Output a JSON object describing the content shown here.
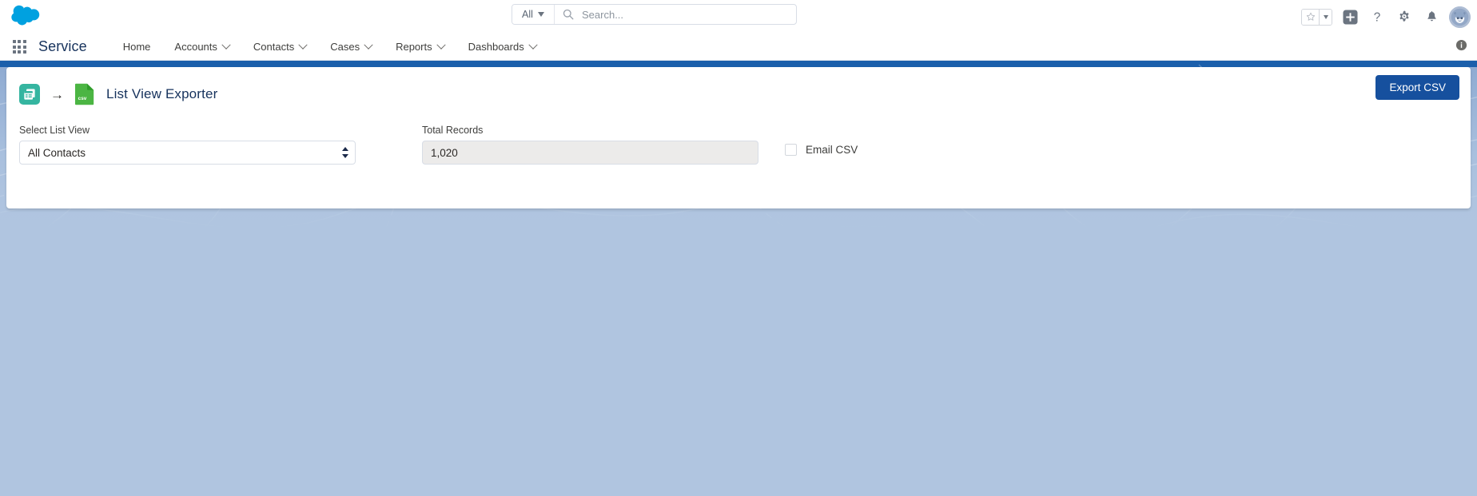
{
  "header": {
    "logo_icon": "salesforce-cloud-logo",
    "search": {
      "scope_label": "All",
      "scope_icon": "chevron-down-icon",
      "search_icon": "search-icon",
      "placeholder": "Search...",
      "value": ""
    },
    "actions": {
      "favorites_icon": "star-icon",
      "favorites_caret_icon": "chevron-down-icon",
      "add_icon": "plus-icon",
      "help_icon": "question-mark-icon",
      "setup_icon": "gear-icon",
      "notifications_icon": "bell-icon",
      "avatar_icon": "user-avatar"
    }
  },
  "nav": {
    "waffle_icon": "app-launcher-icon",
    "app_name": "Service",
    "items": [
      {
        "label": "Home",
        "has_menu": false
      },
      {
        "label": "Accounts",
        "has_menu": true
      },
      {
        "label": "Contacts",
        "has_menu": true
      },
      {
        "label": "Cases",
        "has_menu": true
      },
      {
        "label": "Reports",
        "has_menu": true
      },
      {
        "label": "Dashboards",
        "has_menu": true
      }
    ],
    "info_icon": "info-icon"
  },
  "card": {
    "source_icon": "list-view-icon",
    "arrow": "→",
    "target_icon": "csv-file-icon",
    "csv_icon_label": "csv",
    "title": "List View Exporter",
    "export_button": "Export CSV",
    "fields": {
      "list_view": {
        "label": "Select List View",
        "value": "All Contacts",
        "options": [
          "All Contacts"
        ],
        "stepper_icon": "up-down-stepper-icon"
      },
      "total_records": {
        "label": "Total Records",
        "value": "1,020",
        "readonly": true
      },
      "email_csv": {
        "label": "Email CSV",
        "checked": false
      }
    }
  },
  "colors": {
    "brand_blue": "#16509e",
    "nav_title_blue": "#16325c",
    "canvas_blue": "#b0c5e0",
    "canvas_band_blue": "#1b5fab",
    "listview_teal": "#35b5a0",
    "csv_green": "#4bb543",
    "readonly_grey": "#ecebea"
  }
}
